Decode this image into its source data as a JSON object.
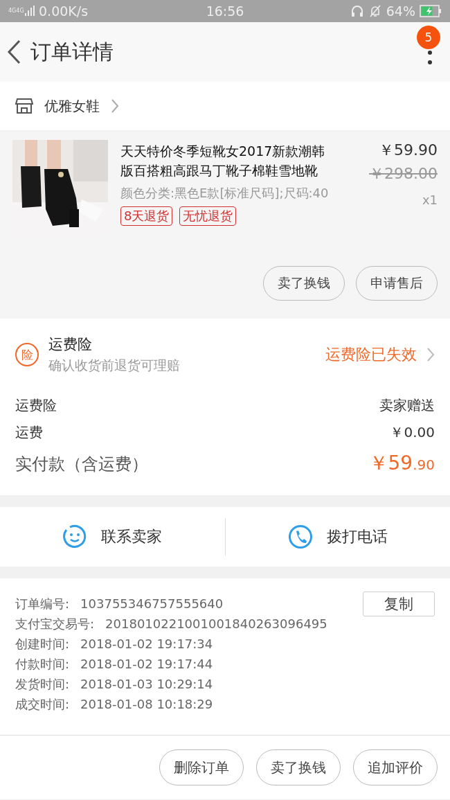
{
  "status_bar": {
    "network": "4G4G",
    "speed": "0.00K/s",
    "time": "16:56",
    "battery": "64%"
  },
  "header": {
    "title": "订单详情",
    "badge": "5"
  },
  "store": {
    "name": "优雅女鞋"
  },
  "product": {
    "title": "天天特价冬季短靴女2017新款潮韩版百搭粗高跟马丁靴子棉鞋雪地靴",
    "sku": "颜色分类:黑色E款[标准尺码];尺码:40",
    "price": "￥59.90",
    "original_price": "￥298.00",
    "quantity": "x1",
    "tags": [
      "8天退货",
      "无忧退货"
    ],
    "buttons": [
      "卖了换钱",
      "申请售后"
    ]
  },
  "insurance": {
    "icon_text": "险",
    "title": "运费险",
    "subtitle": "确认收货前退货可理赔",
    "status": "运费险已失效"
  },
  "fees": [
    {
      "kind": "plain",
      "label": "运费险",
      "value": "卖家赠送"
    },
    {
      "kind": "plain",
      "label": "运费",
      "value": "￥0.00"
    },
    {
      "kind": "total",
      "label": "实付款（含运费）",
      "value": "￥59",
      "value_small": ".90"
    }
  ],
  "contact": [
    {
      "kind": "chat",
      "label": "联系卖家"
    },
    {
      "kind": "phone",
      "label": "拨打电话"
    }
  ],
  "info": {
    "copy_button": "复制",
    "rows": [
      {
        "label": "订单编号:",
        "value": "103755346757555640"
      },
      {
        "label": "支付宝交易号:",
        "value": "2018010221001001840263096495"
      },
      {
        "label": "创建时间:",
        "value": "2018-01-02 19:17:34"
      },
      {
        "label": "付款时间:",
        "value": "2018-01-02 19:17:44"
      },
      {
        "label": "发货时间:",
        "value": "2018-01-03 10:29:14"
      },
      {
        "label": "成交时间:",
        "value": "2018-01-08 10:18:29"
      }
    ]
  },
  "actions": [
    "删除订单",
    "卖了换钱",
    "追加评价"
  ]
}
